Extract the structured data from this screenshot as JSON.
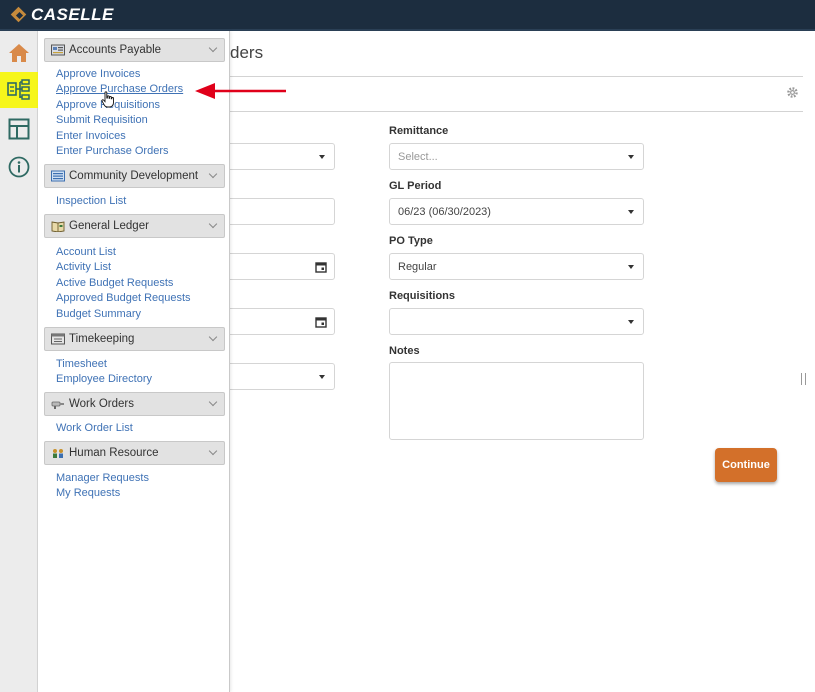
{
  "app": {
    "brand": "CASELLE"
  },
  "page": {
    "title_partial": "ders"
  },
  "form": {
    "remittance": {
      "label": "Remittance",
      "placeholder": "Select..."
    },
    "gl_period": {
      "label": "GL Period",
      "value": "06/23 (06/30/2023)"
    },
    "po_type": {
      "label": "PO Type",
      "value": "Regular"
    },
    "requisitions": {
      "label": "Requisitions",
      "value": ""
    },
    "notes": {
      "label": "Notes",
      "value": ""
    },
    "continue_label": "Continue"
  },
  "menu": {
    "sections": [
      {
        "title": "Accounts Payable",
        "icon": "accounts-payable-icon",
        "items": [
          "Approve Invoices",
          "Approve Purchase Orders",
          "Approve Requisitions",
          "Submit Requisition",
          "Enter Invoices",
          "Enter Purchase Orders"
        ]
      },
      {
        "title": "Community Development",
        "icon": "community-development-icon",
        "items": [
          "Inspection List"
        ]
      },
      {
        "title": "General Ledger",
        "icon": "general-ledger-icon",
        "items": [
          "Account List",
          "Activity List",
          "Active Budget Requests",
          "Approved Budget Requests",
          "Budget Summary"
        ]
      },
      {
        "title": "Timekeeping",
        "icon": "timekeeping-icon",
        "items": [
          "Timesheet",
          "Employee Directory"
        ]
      },
      {
        "title": "Work Orders",
        "icon": "work-orders-icon",
        "items": [
          "Work Order List"
        ]
      },
      {
        "title": "Human Resource",
        "icon": "human-resource-icon",
        "items": [
          "Manager Requests",
          "My Requests"
        ]
      }
    ]
  },
  "colors": {
    "topbar": "#1c2d3f",
    "accent": "#d3702a",
    "link": "#3f72b5",
    "active_rail": "#f6f61b",
    "annotation": "#e0001a"
  }
}
